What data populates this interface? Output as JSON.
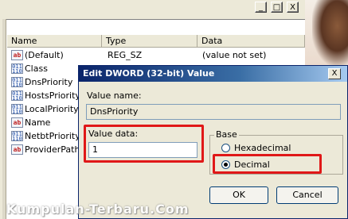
{
  "window": {
    "min_glyph": "_",
    "max_glyph": "□",
    "close_glyph": "X"
  },
  "columns": {
    "name": "Name",
    "type": "Type",
    "data": "Data"
  },
  "rows": [
    {
      "icon": "ab",
      "name": "(Default)",
      "type": "REG_SZ",
      "data": "(value not set)"
    },
    {
      "icon": "bin",
      "name": "Class",
      "type": "",
      "data": ""
    },
    {
      "icon": "bin",
      "name": "DnsPriority",
      "type": "",
      "data": ""
    },
    {
      "icon": "bin",
      "name": "HostsPriority",
      "type": "",
      "data": ""
    },
    {
      "icon": "bin",
      "name": "LocalPriority",
      "type": "",
      "data": ""
    },
    {
      "icon": "ab",
      "name": "Name",
      "type": "",
      "data": ""
    },
    {
      "icon": "bin",
      "name": "NetbtPriority",
      "type": "",
      "data": ""
    },
    {
      "icon": "ab",
      "name": "ProviderPath",
      "type": "",
      "data": ""
    }
  ],
  "dialog": {
    "title": "Edit DWORD (32-bit) Value",
    "close_glyph": "X",
    "value_name_label": "Value name:",
    "value_name": "DnsPriority",
    "value_data_label": "Value data:",
    "value_data": "1",
    "base_label": "Base",
    "hex_label": "Hexadecimal",
    "dec_label": "Decimal",
    "selected_base": "Decimal",
    "ok_label": "OK",
    "cancel_label": "Cancel"
  },
  "watermark": "Kumpulan-Terbaru.Com",
  "colors": {
    "highlight": "#e01818",
    "title_start": "#0a246a",
    "title_end": "#a6caf0"
  }
}
